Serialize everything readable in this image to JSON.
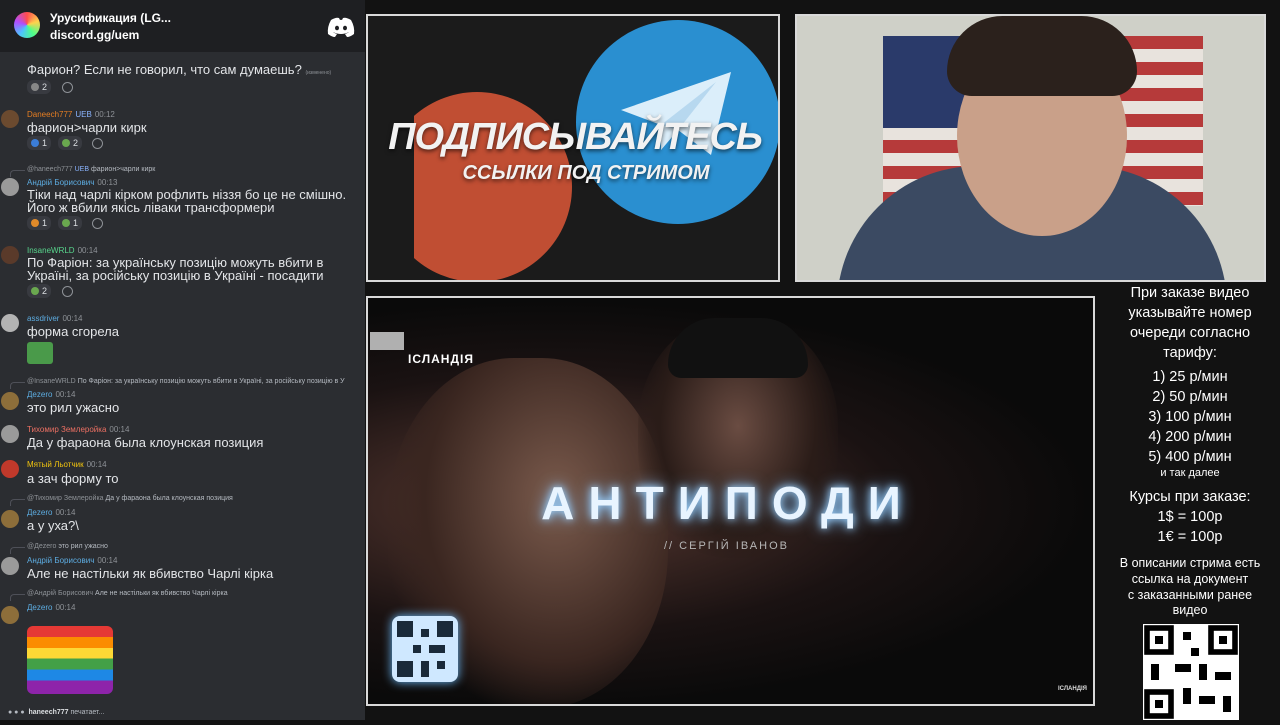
{
  "server": {
    "name": "Урусификация (LG...",
    "invite": "discord.gg/uem"
  },
  "chat": {
    "messages": [
      {
        "text": "Фарион? Если не говорил, что сам думаешь?",
        "edited": "(изменено)",
        "reactions": [
          "2"
        ]
      },
      {
        "author": "Daneech777",
        "badge": "UEB",
        "time": "00:12",
        "text": "фарион>чарли кирк",
        "reactions": [
          "1",
          "2"
        ]
      },
      {
        "reply_author": "@haneech777",
        "reply_badge": "UEB",
        "reply_text": "фарион>чарли кирк",
        "author": "Андрій Борисович",
        "time": "00:13",
        "text": "Тіки над чарлі кірком рофлить ніззя бо це не смішно. Його ж вбили якісь ліваки трансформери",
        "reactions": [
          "1",
          "1"
        ]
      },
      {
        "author": "InsaneWRLD",
        "time": "00:14",
        "text": "По Фаріон: за українську позицію можуть вбити в Україні, за російську позицію в Україні - посадити",
        "reactions": [
          "2"
        ]
      },
      {
        "author": "assdriver",
        "time": "00:14",
        "text": "форма сгорела"
      },
      {
        "reply_author": "@InsaneWRLD",
        "reply_text": "По Фаріон: за українську позицію можуть вбити в Україні, за російську позицію в У",
        "author": "Дezero",
        "time": "00:14",
        "text": "это рил ужасно"
      },
      {
        "author": "Тихомир Землеройка",
        "time": "00:14",
        "text": "Да у фараона была клоунская позиция"
      },
      {
        "author": "Мятый Льотчик",
        "time": "00:14",
        "text": "а зач форму то"
      },
      {
        "reply_author": "@Тихомир Землеройка",
        "reply_text": "Да у фараона была клоунская позиция",
        "author": "Дezero",
        "time": "00:14",
        "text": "а у уха?\\"
      },
      {
        "reply_author": "@Дezero",
        "reply_text": "это рил ужасно",
        "author": "Андрій Борисович",
        "time": "00:14",
        "text": "Але не настільки як вбивство Чарлі кірка"
      },
      {
        "reply_author": "@Андрій Борисович",
        "reply_text": "Але не настільки як вбивство Чарлі кірка",
        "author": "Дezero",
        "time": "00:14",
        "text": ""
      }
    ],
    "typing": {
      "user": "haneech777",
      "suffix": "печатает..."
    }
  },
  "promo": {
    "headline": "ПОДПИСЫВАЙТЕСЬ",
    "subline": "ССЫЛКИ ПОД СТРИМОМ"
  },
  "video": {
    "channel": "ІСЛАНДІЯ",
    "title": "АНТИПОДИ",
    "author": "// СЕРГІЙ ІВАНОВ",
    "watermark": "ІСЛАНДІЯ"
  },
  "info": {
    "intro": [
      "При заказе видео",
      "указывайте номер",
      "очереди согласно",
      "тарифу:"
    ],
    "rates": [
      "1) 25 р/мин",
      "2) 50 р/мин",
      "3) 100 р/мин",
      "4) 200 р/мин",
      "5) 400 р/мин"
    ],
    "etc": "и так далее",
    "courses_title": "Курсы при заказе:",
    "courses": [
      "1$ = 100р",
      "1€ = 100р"
    ],
    "desc": [
      "В описании стрима есть",
      "ссылка на документ",
      "с заказанными ранее",
      "видео"
    ]
  },
  "colors": {
    "chat_bg": "#2b2d31",
    "server_bar": "#1e1f22",
    "patreon": "#c04e33",
    "telegram": "#2a8fd0",
    "title_glow": "#9fd4ff"
  }
}
